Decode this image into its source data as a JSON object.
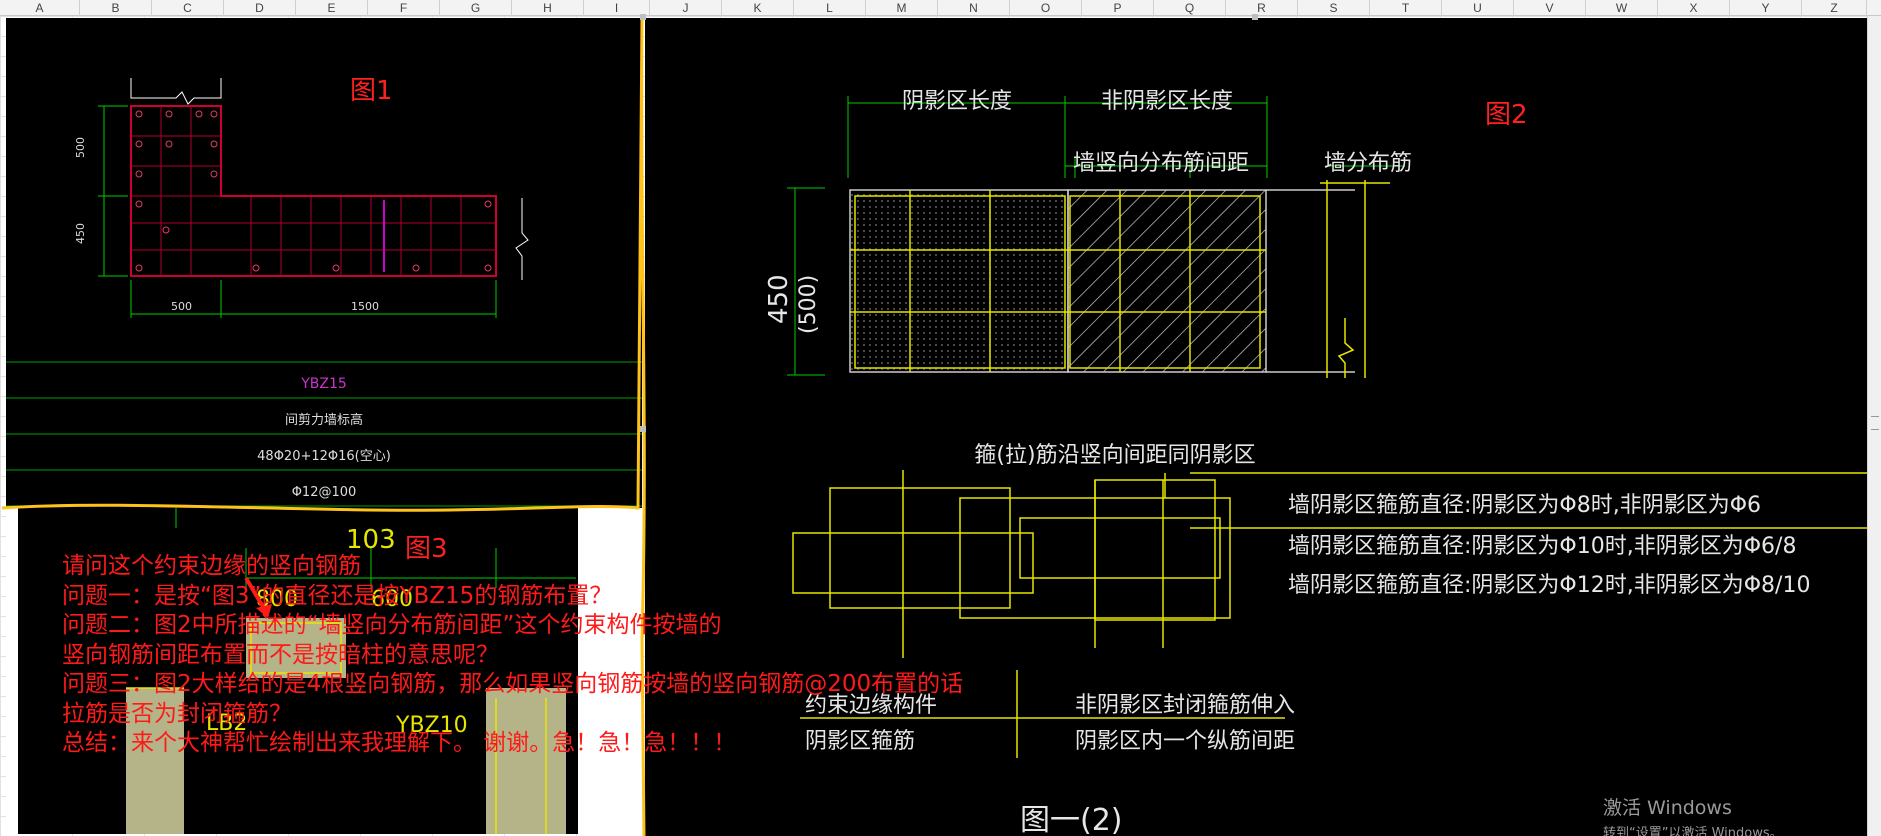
{
  "columns": [
    "A",
    "B",
    "C",
    "D",
    "E",
    "F",
    "G",
    "H",
    "I",
    "J",
    "K",
    "L",
    "M",
    "N",
    "O",
    "P",
    "Q",
    "R",
    "S",
    "T",
    "U",
    "V",
    "W",
    "X",
    "Y",
    "Z"
  ],
  "figure_labels": {
    "fig1": "图1",
    "fig2": "图2",
    "fig3": "图3"
  },
  "figure1": {
    "dim_top_left": "500",
    "dim_left_lower": "450",
    "dim_bottom_left": "500",
    "dim_bottom_right": "1500",
    "table": {
      "name": "YBZ15",
      "elevation": "间剪力墙标高",
      "longitudinal_bars": "48Φ20+12Φ16(空心)",
      "stirrups": "Φ12@100"
    }
  },
  "figure2": {
    "dim_shadow_length": "阴影区长度",
    "dim_non_shadow_length": "非阴影区长度",
    "dim_wall_vertical_spacing": "墙竖向分布筋间距",
    "label_wall_distribution": "墙分布筋",
    "dim_height": "450",
    "dim_height_alt": "(500)",
    "note_stirrup_spacing": "箍(拉)筋沿竖向间距同阴影区",
    "rules": [
      "墙阴影区箍筋直径:阴影区为Φ8时,非阴影区为Φ6",
      "墙阴影区箍筋直径:阴影区为Φ10时,非阴影区为Φ6/8",
      "墙阴影区箍筋直径:阴影区为Φ12时,非阴影区为Φ8/10"
    ],
    "label_boundary_member": "约束边缘构件",
    "label_shadow_stirrup": "阴影区箍筋",
    "label_non_shadow_closed": "非阴影区封闭箍筋伸入",
    "label_non_shadow_spacing": "阴影区内一个纵筋间距",
    "caption": "图一(2)"
  },
  "figure3": {
    "dim_a": "800",
    "dim_b": "600",
    "label_a": "103",
    "label_ybz": "YBZ10",
    "label_lb": "LB2"
  },
  "question_lines": [
    "请问这个约束边缘的竖向钢筋",
    "问题一：是按“图3”的直径还是按YBZ15的钢筋布置？",
    "问题二：图2中所描述的“墙竖向分布筋间距”这个约束构件按墙的",
    "竖向钢筋间距布置而不是按暗柱的意思呢？",
    "问题三：图2大样给的是4根竖向钢筋，那么如果竖向钢筋按墙的竖向钢筋@200布置的话",
    "拉筋是否为封闭箍筋？",
    "总结：来个大神帮忙绘制出来我理解下。 谢谢。急！急！急！！！"
  ],
  "watermark": {
    "title": "激活 Windows",
    "subtitle": "转到“设置”以激活 Windows。"
  },
  "colors": {
    "cad_background": "#000000",
    "cad_yellow": "#e6e600",
    "cad_green": "#00cc00",
    "cad_red": "#cc0033",
    "cad_magenta": "#cc00cc",
    "annotation_red": "#ff1a1a",
    "highlight_yellow": "#ffc21a"
  }
}
